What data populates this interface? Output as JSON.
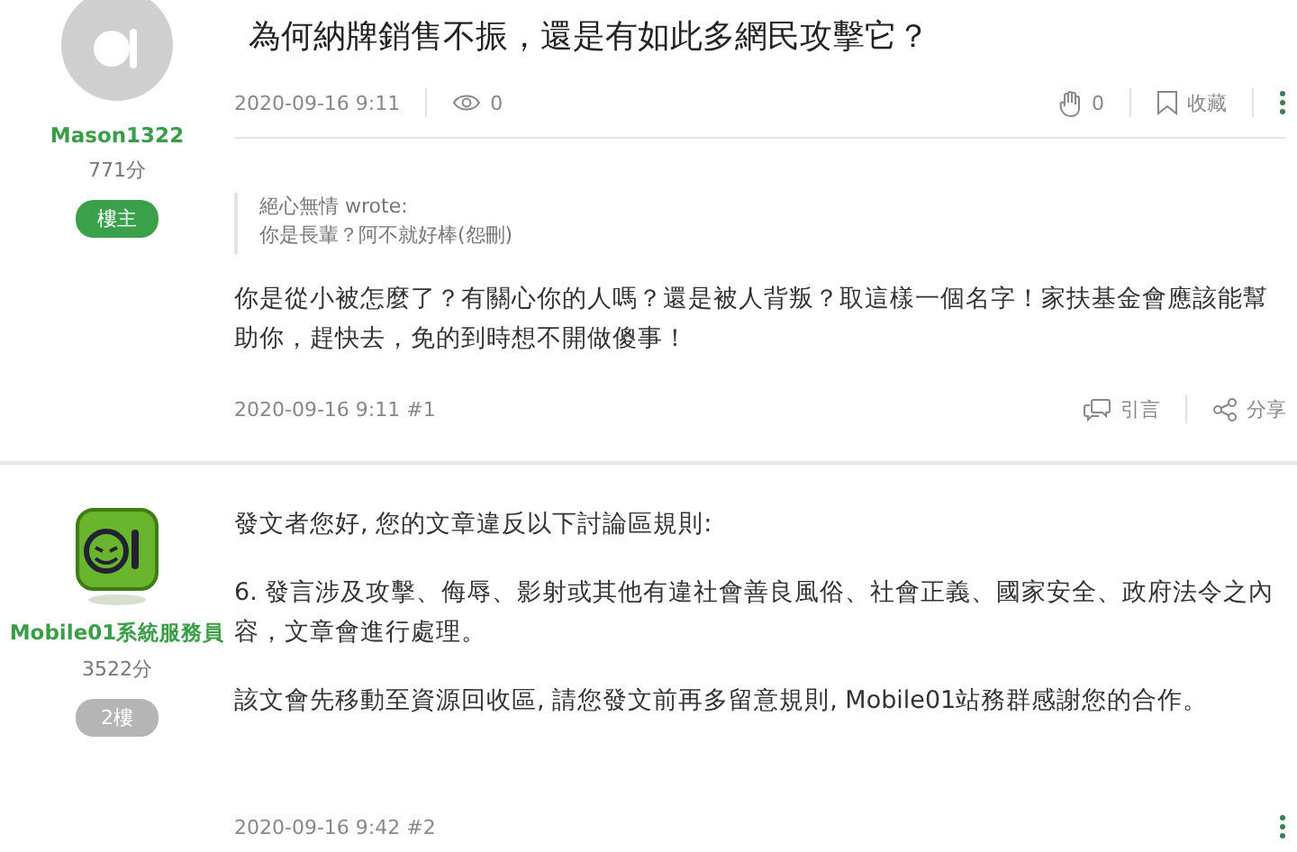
{
  "title": "為何納牌銷售不振，還是有如此多網民攻擊它？",
  "posts": [
    {
      "author": {
        "name": "Mason1322",
        "score": "771分",
        "avatar": {
          "kind": "placeholder"
        },
        "badge": {
          "label": "樓主",
          "kind": "op"
        }
      },
      "stats": {
        "date": "2020-09-16 9:11",
        "views": "0",
        "likes": "0",
        "bookmark": "收藏"
      },
      "quote": {
        "author": "絕心無情 wrote:",
        "text": "你是長輩？阿不就好棒(怨刪)"
      },
      "paragraphs": [
        "你是從小被怎麼了？有關心你的人嗎？還是被人背叛？取這樣一個名字！家扶基金會應該能幫助你，趕快去，免的到時想不開做傻事！"
      ],
      "footer": {
        "stamp": "2020-09-16 9:11 #1",
        "actions": [
          {
            "kind": "quote",
            "label": "引言"
          },
          {
            "kind": "share",
            "label": "分享"
          }
        ]
      }
    },
    {
      "author": {
        "name": "Mobile01系統服務員",
        "score": "3522分",
        "avatar": {
          "kind": "logo"
        },
        "badge": {
          "label": "2樓",
          "kind": "floor"
        }
      },
      "paragraphs": [
        "發文者您好, 您的文章違反以下討論區規則:",
        "6. 發言涉及攻擊、侮辱、影射或其他有違社會善良風俗、社會正義、國家安全、政府法令之內容，文章會進行處理。",
        "該文會先移動至資源回收區, 請您發文前再多留意規則, Mobile01站務群感謝您的合作。"
      ],
      "footer": {
        "stamp": "2020-09-16 9:42 #2",
        "more": true
      }
    }
  ]
}
